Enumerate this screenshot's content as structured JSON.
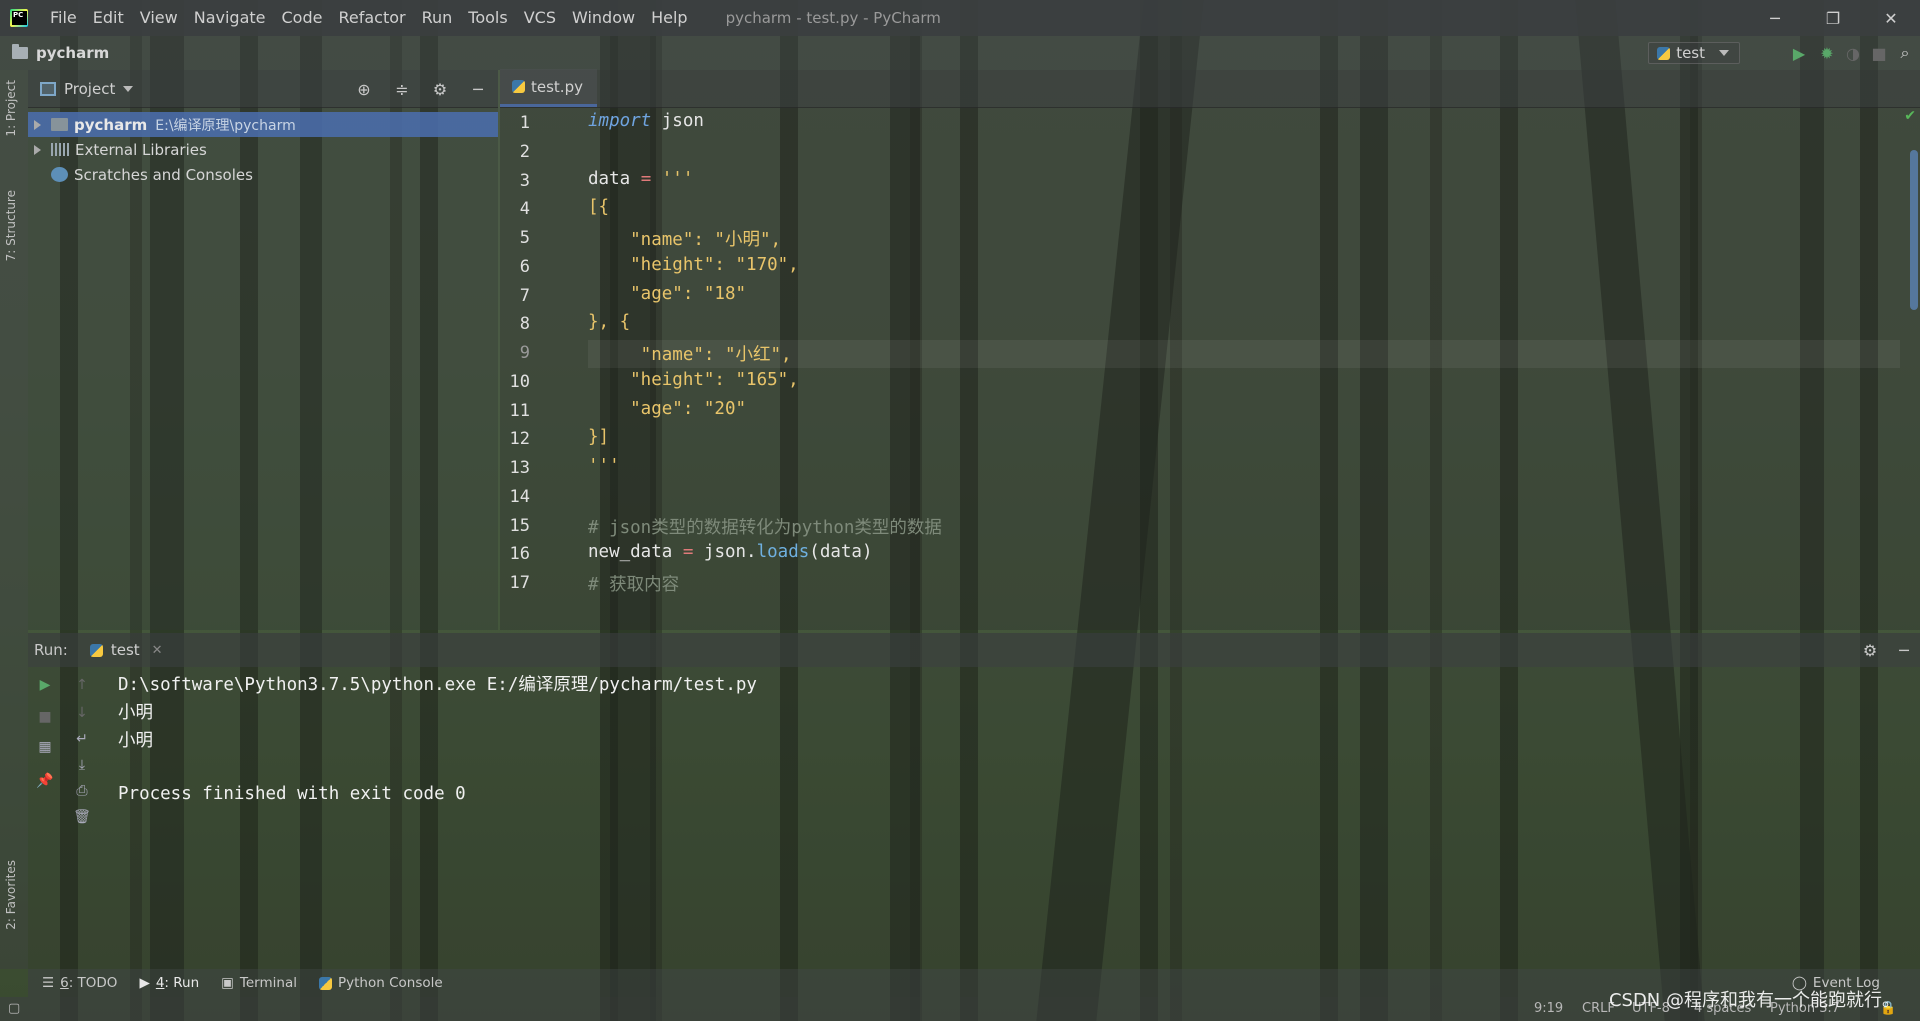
{
  "titlebar": {
    "menu": [
      "File",
      "Edit",
      "View",
      "Navigate",
      "Code",
      "Refactor",
      "Run",
      "Tools",
      "VCS",
      "Window",
      "Help"
    ],
    "window_title": "pycharm - test.py - PyCharm"
  },
  "navbar": {
    "project_name": "pycharm",
    "run_config": "test"
  },
  "left_stripe": {
    "project_label": "1: Project",
    "structure_label": "7: Structure",
    "favorites_label": "2: Favorites"
  },
  "project_panel": {
    "title": "Project",
    "tree": [
      {
        "name": "pycharm",
        "path": "E:\\编译原理\\pycharm"
      },
      {
        "name": "External Libraries"
      },
      {
        "name": "Scratches and Consoles"
      }
    ]
  },
  "editor": {
    "tab": "test.py",
    "line_numbers": [
      "1",
      "2",
      "3",
      "4",
      "5",
      "6",
      "7",
      "8",
      "9",
      "10",
      "11",
      "12",
      "13",
      "14",
      "15",
      "16",
      "17"
    ],
    "lines": [
      {
        "kw": "import",
        "rest": " json"
      },
      {
        "text": ""
      },
      {
        "var": "data ",
        "op": "=",
        "str": " '''"
      },
      {
        "str": "[{"
      },
      {
        "str": "    \"name\": \"小明\","
      },
      {
        "str": "    \"height\": \"170\","
      },
      {
        "str": "    \"age\": \"18\""
      },
      {
        "str": "}, {"
      },
      {
        "str": "     \"name\": \"小红\","
      },
      {
        "str": "    \"height\": \"165\","
      },
      {
        "str": "    \"age\": \"20\""
      },
      {
        "str": "}]"
      },
      {
        "str": "'''"
      },
      {
        "text": ""
      },
      {
        "cm": "# json类型的数据转化为python类型的数据"
      },
      {
        "var": "new_data ",
        "op": "=",
        "rest1": " json.",
        "fn": "loads",
        "rest2": "(data)"
      },
      {
        "cm": "# 获取内容"
      }
    ]
  },
  "run_panel": {
    "label": "Run:",
    "tab": "test",
    "output": [
      "D:\\software\\Python3.7.5\\python.exe E:/编译原理/pycharm/test.py",
      "小明",
      "小明",
      "",
      "Process finished with exit code 0"
    ]
  },
  "toolwindows": {
    "todo_num": "6",
    "todo_label": ": TODO",
    "run_num": "4",
    "run_label": ": Run",
    "terminal": "Terminal",
    "python_console": "Python Console",
    "event_log": "Event Log"
  },
  "statusbar": {
    "position": "9:19",
    "line_sep": "CRLF",
    "encoding": "UTF-8",
    "indent": "4 spaces",
    "interpreter": "Python 3.7",
    "watermark": "CSDN @程序和我有一个能跑就行。"
  },
  "colors": {
    "selection": "#4b6eaf",
    "keyword": "#6fa4e0",
    "string": "#e8c46a",
    "operator": "#e07a7a",
    "comment": "#7e8a7a",
    "run_green": "#59a869"
  }
}
